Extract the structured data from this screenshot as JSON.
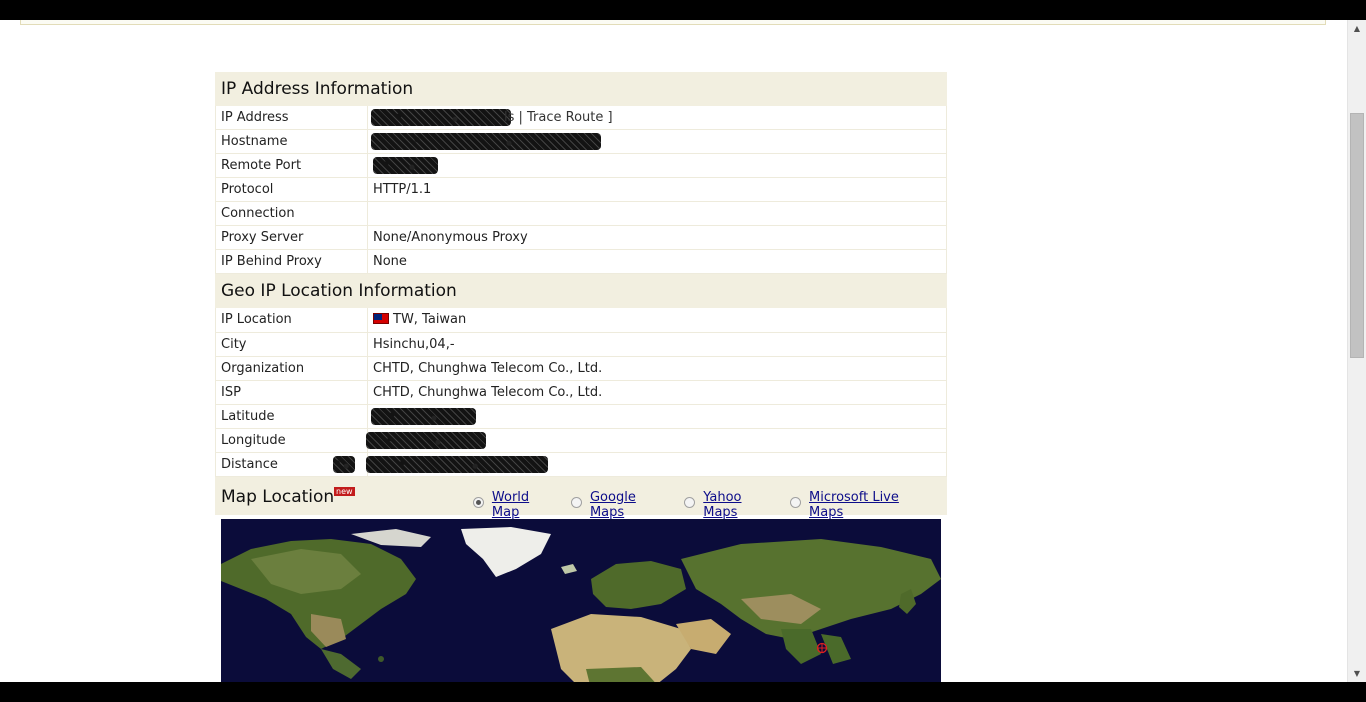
{
  "ip_section": {
    "title": "IP Address Information",
    "rows": [
      {
        "label": "IP Address",
        "value": "ls | Trace Route ]"
      },
      {
        "label": "Hostname",
        "value": ""
      },
      {
        "label": "Remote Port",
        "value": ""
      },
      {
        "label": "Protocol",
        "value": "HTTP/1.1"
      },
      {
        "label": "Connection",
        "value": ""
      },
      {
        "label": "Proxy Server",
        "value": "None/Anonymous Proxy"
      },
      {
        "label": "IP Behind Proxy",
        "value": "None"
      }
    ]
  },
  "geo_section": {
    "title": "Geo IP Location Information",
    "rows": [
      {
        "label": "IP Location",
        "value": "TW, Taiwan",
        "icon": "taiwan-flag-icon"
      },
      {
        "label": "City",
        "value": "Hsinchu,04,-"
      },
      {
        "label": "Organization",
        "value": "CHTD, Chunghwa Telecom Co., Ltd."
      },
      {
        "label": "ISP",
        "value": "CHTD, Chunghwa Telecom Co., Ltd."
      },
      {
        "label": "Latitude",
        "value": ""
      },
      {
        "label": "Longitude",
        "value": ""
      },
      {
        "label": "Distance",
        "value": ""
      }
    ]
  },
  "map_section": {
    "title": "Map Location",
    "badge": "new",
    "options": [
      {
        "label": "World Map",
        "selected": true
      },
      {
        "label": "Google Maps",
        "selected": false
      },
      {
        "label": "Yahoo Maps",
        "selected": false
      },
      {
        "label": "Microsoft Live Maps",
        "selected": false
      }
    ]
  },
  "colors": {
    "header_bg": "#f2efe0",
    "row_border": "#eeebdc",
    "link": "#0d0d8a",
    "badge": "#c21c1c",
    "ocean": "#0b0c3a"
  }
}
